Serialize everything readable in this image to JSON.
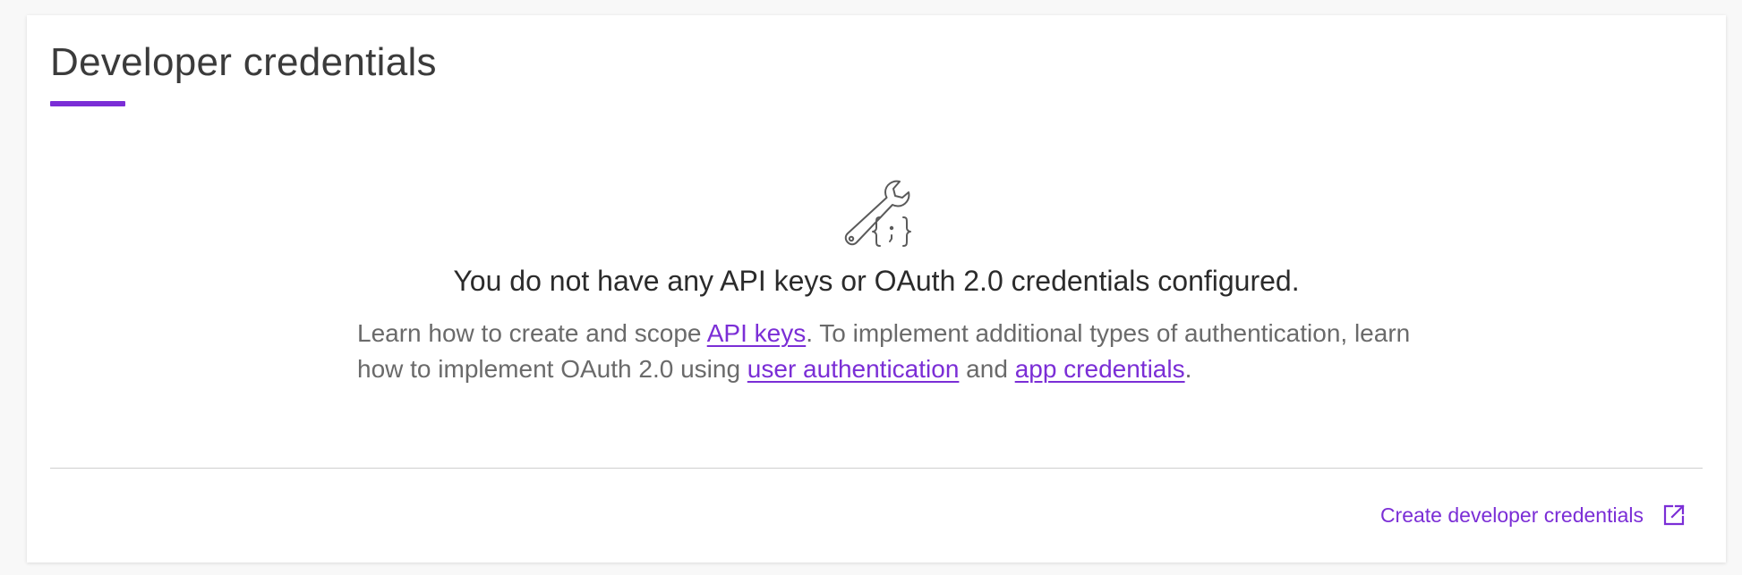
{
  "page": {
    "title": "Developer credentials",
    "accent_color": "#7b2ed6"
  },
  "empty_state": {
    "icon": "wrench-code-icon",
    "heading": "You do not have any API keys or OAuth 2.0 credentials configured.",
    "desc_part1": "Learn how to create and scope ",
    "link_api_keys": "API keys",
    "desc_part2": ". To implement additional types of authentication, learn how to implement OAuth 2.0 using ",
    "link_user_auth": "user authentication",
    "desc_part3": " and ",
    "link_app_credentials": "app credentials",
    "desc_part4": "."
  },
  "footer": {
    "action_label": "Create developer credentials",
    "action_icon": "external-link-icon"
  }
}
